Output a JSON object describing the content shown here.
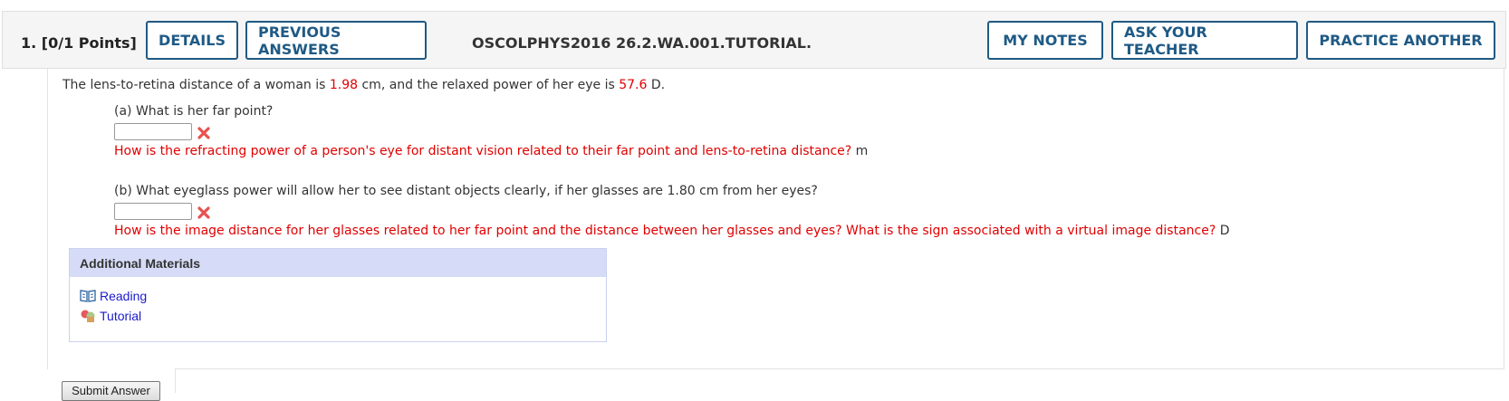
{
  "header": {
    "question_number": "1.",
    "points": "[0/1 Points]",
    "details_label": "DETAILS",
    "previous_answers_label": "PREVIOUS ANSWERS",
    "assignment_code": "OSCOLPHYS2016 26.2.WA.001.TUTORIAL.",
    "my_notes_label": "MY NOTES",
    "ask_teacher_label": "ASK YOUR TEACHER",
    "practice_another_label": "PRACTICE ANOTHER"
  },
  "question": {
    "stem_part1": "The lens-to-retina distance of a woman is ",
    "stem_value1": "1.98",
    "stem_part2": " cm, and the relaxed power of her eye is ",
    "stem_value2": "57.6",
    "stem_part3": " D.",
    "part_a": {
      "prompt": "(a) What is her far point?",
      "value": "",
      "hint": "How is the refracting power of a person's eye for distant vision related to their far point and lens-to-retina distance?",
      "unit": "m"
    },
    "part_b": {
      "prompt": "(b) What eyeglass power will allow her to see distant objects clearly, if her glasses are 1.80 cm from her eyes?",
      "value": "",
      "hint": "How is the image distance for her glasses related to her far point and the distance between her glasses and eyes? What is the sign associated with a virtual image distance?",
      "unit": "D"
    }
  },
  "additional_materials": {
    "title": "Additional Materials",
    "items": [
      {
        "label": "Reading",
        "icon": "book-icon"
      },
      {
        "label": "Tutorial",
        "icon": "tutorial-icon"
      }
    ]
  },
  "submit_label": "Submit Answer",
  "colors": {
    "accent": "#1f5a85",
    "error": "#e00000",
    "link": "#1a1acc",
    "materials_header": "#d6dcf7"
  }
}
